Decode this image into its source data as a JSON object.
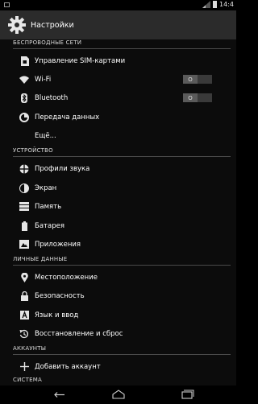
{
  "status_bar": {
    "time": "14:4"
  },
  "action_bar": {
    "title": "Настройки",
    "icon": "settings-gear-icon"
  },
  "sections": [
    {
      "header": "БЕСПРОВОДНЫЕ СЕТИ",
      "items": [
        {
          "label": "Управление SIM-картами",
          "icon": "sim-card-icon"
        },
        {
          "label": "Wi-Fi",
          "icon": "wifi-icon",
          "toggle": "O"
        },
        {
          "label": "Bluetooth",
          "icon": "bluetooth-icon",
          "toggle": "O"
        },
        {
          "label": "Передача данных",
          "icon": "data-usage-icon"
        },
        {
          "label": "Ещё..."
        }
      ]
    },
    {
      "header": "УСТРОЙСТВО",
      "items": [
        {
          "label": "Профили звука",
          "icon": "sound-icon"
        },
        {
          "label": "Экран",
          "icon": "display-icon"
        },
        {
          "label": "Память",
          "icon": "storage-icon"
        },
        {
          "label": "Батарея",
          "icon": "battery-icon"
        },
        {
          "label": "Приложения",
          "icon": "apps-icon"
        }
      ]
    },
    {
      "header": "ЛИЧНЫЕ ДАННЫЕ",
      "items": [
        {
          "label": "Местоположение",
          "icon": "location-icon"
        },
        {
          "label": "Безопасность",
          "icon": "lock-icon"
        },
        {
          "label": "Язык и ввод",
          "icon": "language-icon"
        },
        {
          "label": "Восстановление и сброс",
          "icon": "restore-icon"
        }
      ]
    },
    {
      "header": "АККАУНТЫ",
      "items": [
        {
          "label": "Добавить аккаунт",
          "icon": "add-icon"
        }
      ]
    },
    {
      "header": "СИСТЕМА",
      "items": []
    }
  ],
  "nav_bar": {
    "buttons": [
      "back-icon",
      "home-icon",
      "recents-icon"
    ]
  }
}
